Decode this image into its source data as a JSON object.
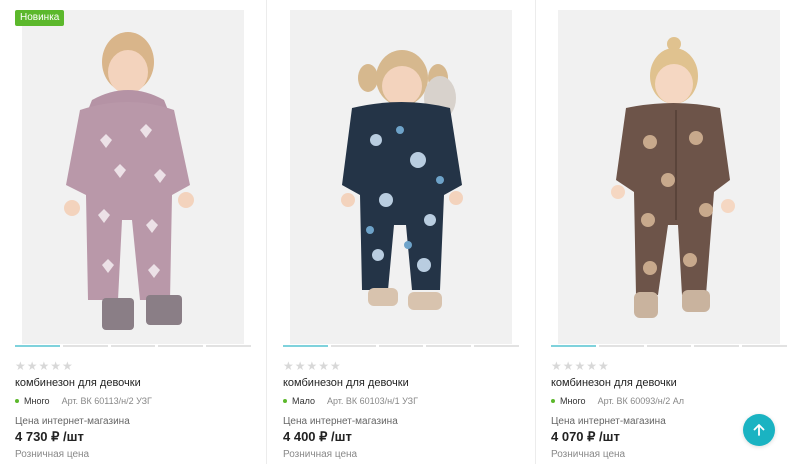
{
  "badge": {
    "new_label": "Новинка"
  },
  "colors": {
    "accent": "#1ab3c2",
    "badge_green": "#5cb82c",
    "stock_dot": "#5cb82c",
    "active_dot": "#7fd2dc"
  },
  "scroll_up_icon": "arrow-up-icon",
  "products": [
    {
      "stars": "★★★★★",
      "name": "комбинезон для девочки",
      "stock": "Много",
      "article": "Арт. ВК 60113/н/2 УЗГ",
      "price_label": "Цена интернет-магазина",
      "price": "4 730 ₽ /шт",
      "retail_label": "Розничная цена"
    },
    {
      "stars": "★★★★★",
      "name": "комбинезон для девочки",
      "stock": "Мало",
      "article": "Арт. ВК 60103/н/1 УЗГ",
      "price_label": "Цена интернет-магазина",
      "price": "4 400 ₽ /шт",
      "retail_label": "Розничная цена"
    },
    {
      "stars": "★★★★★",
      "name": "комбинезон для девочки",
      "stock": "Много",
      "article": "Арт. ВК 60093/н/2 Ал",
      "price_label": "Цена интернет-магазина",
      "price": "4 070 ₽ /шт",
      "retail_label": "Розничная цена"
    }
  ]
}
